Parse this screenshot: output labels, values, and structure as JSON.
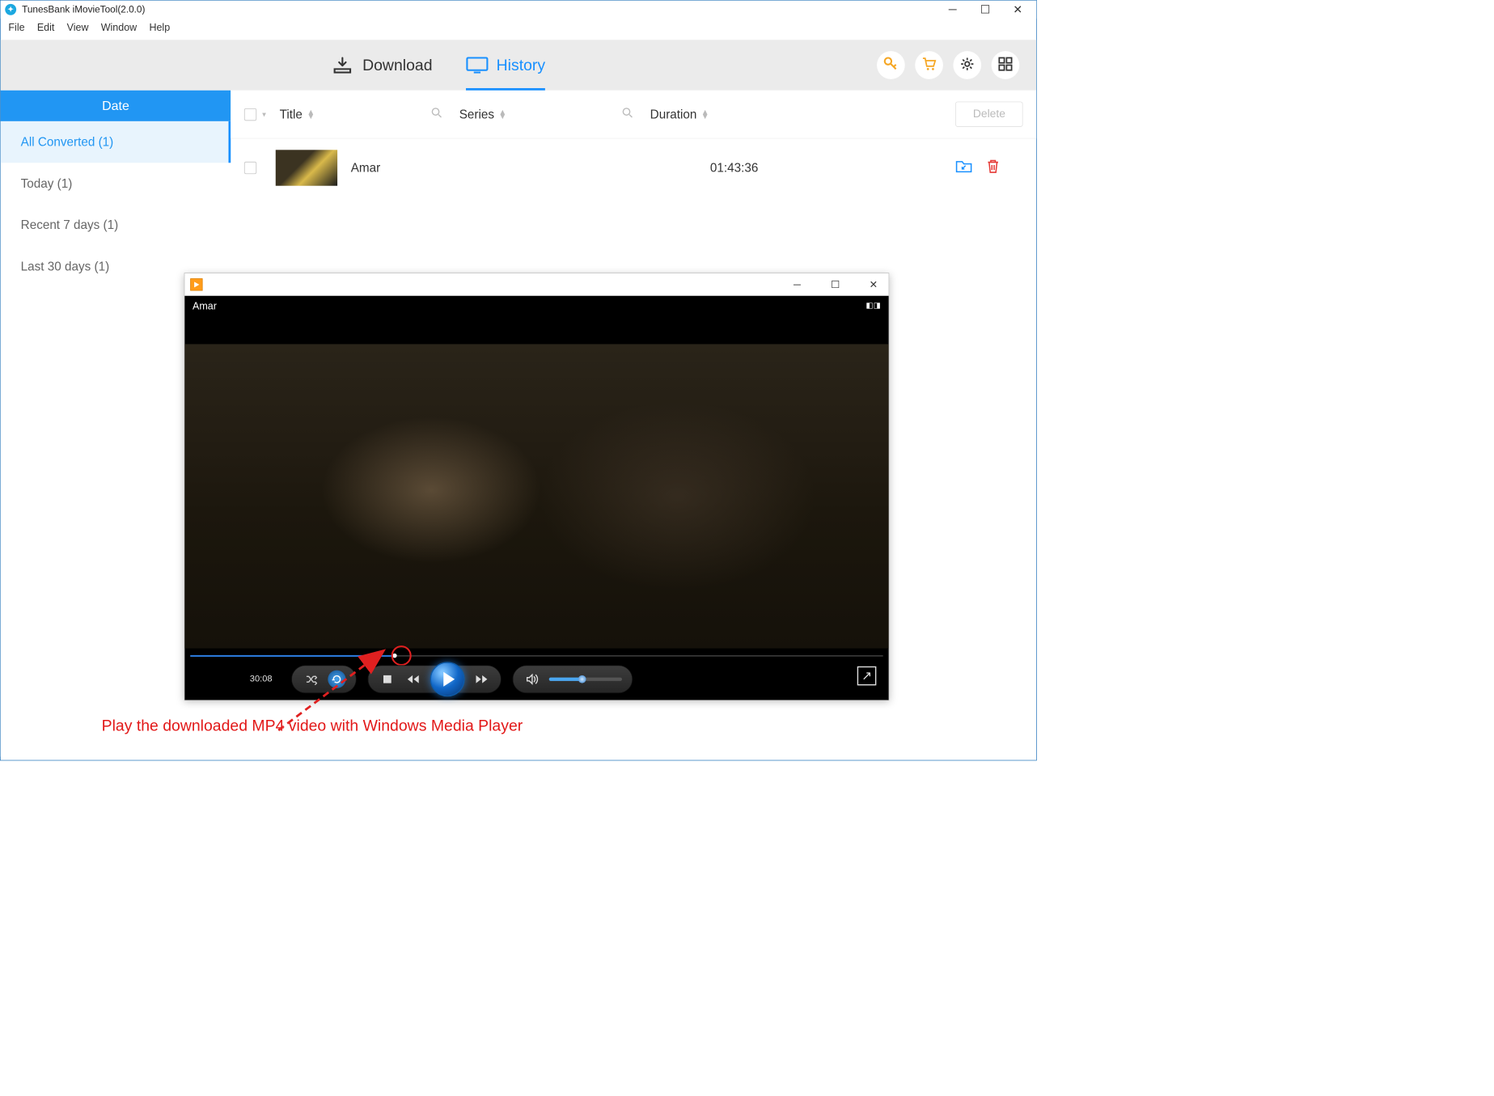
{
  "window": {
    "title": "TunesBank iMovieTool(2.0.0)"
  },
  "menu": {
    "file": "File",
    "edit": "Edit",
    "view": "View",
    "window": "Window",
    "help": "Help"
  },
  "toolbar": {
    "download": "Download",
    "history": "History"
  },
  "sidebar": {
    "header": "Date",
    "items": [
      {
        "label": "All Converted (1)",
        "selected": true
      },
      {
        "label": "Today (1)",
        "selected": false
      },
      {
        "label": "Recent 7 days (1)",
        "selected": false
      },
      {
        "label": "Last 30 days (1)",
        "selected": false
      }
    ]
  },
  "list": {
    "headers": {
      "title": "Title",
      "series": "Series",
      "duration": "Duration"
    },
    "delete": "Delete",
    "rows": [
      {
        "title": "Amar",
        "series": "",
        "duration": "01:43:36"
      }
    ]
  },
  "player": {
    "video_title": "Amar",
    "elapsed": "30:08",
    "progress_pct": 29.5,
    "volume_pct": 45
  },
  "annotation": {
    "caption": "Play the downloaded MP4 video with Windows Media Player"
  }
}
